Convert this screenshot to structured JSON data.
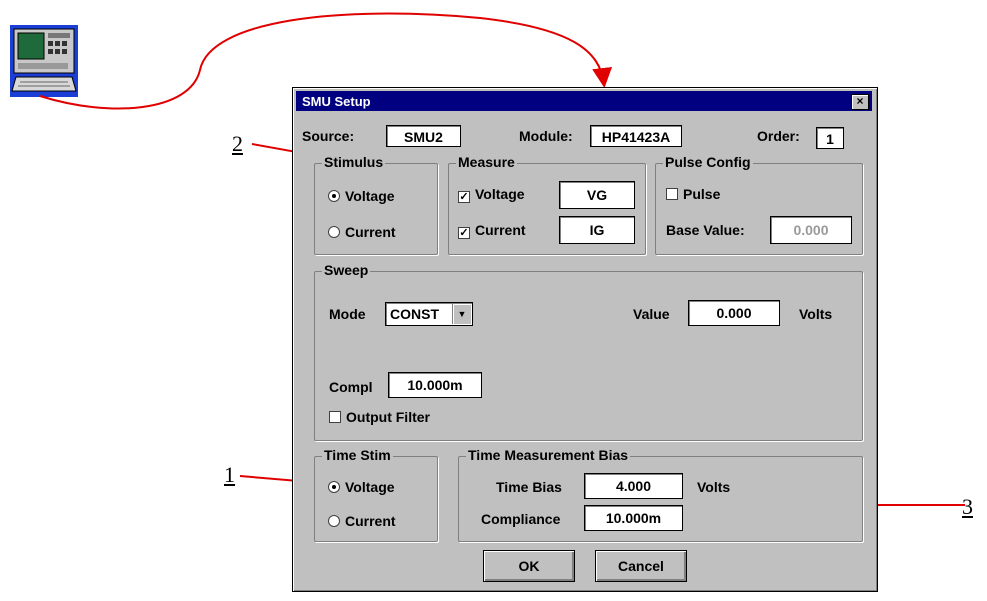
{
  "dialog": {
    "title": "SMU Setup",
    "close_glyph": "×"
  },
  "header": {
    "source_label": "Source:",
    "source_value": "SMU2",
    "module_label": "Module:",
    "module_value": "HP41423A",
    "order_label": "Order:",
    "order_value": "1"
  },
  "stimulus": {
    "legend": "Stimulus",
    "options": [
      "Voltage",
      "Current"
    ],
    "selected": "Voltage"
  },
  "measure": {
    "legend": "Measure",
    "voltage_label": "Voltage",
    "voltage_checked": true,
    "voltage_name": "VG",
    "current_label": "Current",
    "current_checked": true,
    "current_name": "IG"
  },
  "pulse_config": {
    "legend": "Pulse Config",
    "pulse_label": "Pulse",
    "pulse_checked": false,
    "base_value_label": "Base Value:",
    "base_value": "0.000"
  },
  "sweep": {
    "legend": "Sweep",
    "mode_label": "Mode",
    "mode_value": "CONST",
    "value_label": "Value",
    "value": "0.000",
    "value_unit": "Volts",
    "compl_label": "Compl",
    "compl_value": "10.000m",
    "output_filter_label": "Output Filter",
    "output_filter_checked": false
  },
  "time_stim": {
    "legend": "Time Stim",
    "options": [
      "Voltage",
      "Current"
    ],
    "selected": "Voltage"
  },
  "time_measurement_bias": {
    "legend": "Time Measurement Bias",
    "time_bias_label": "Time Bias",
    "time_bias_value": "4.000",
    "time_bias_unit": "Volts",
    "compliance_label": "Compliance",
    "compliance_value": "10.000m"
  },
  "buttons": {
    "ok": "OK",
    "cancel": "Cancel"
  },
  "callouts": [
    "1",
    "2",
    "3"
  ],
  "colors": {
    "arrow": "#e00000",
    "titlebar": "#000080",
    "dialog_face": "#c0c0c0"
  },
  "icons": {
    "instrument": "instrument-computer-icon"
  }
}
